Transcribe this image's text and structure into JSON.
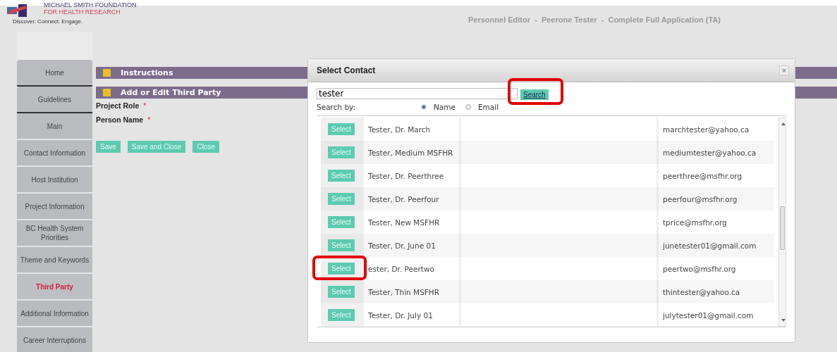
{
  "logo": {
    "line_1": "MICHAEL SMITH FOUNDATION",
    "line_2": "FOR HEALTH RESEARCH",
    "tagline": "Discover. Connect. Engage."
  },
  "page_title": "Personnel Editor  -  Peerone Tester  -  Complete Full Application (TA)",
  "sidebar": {
    "items": [
      {
        "label": "Home",
        "selected": false
      },
      {
        "label": "Guidelines",
        "selected": false
      },
      {
        "label": "Main",
        "selected": false
      },
      {
        "label": "Contact Information",
        "selected": false
      },
      {
        "label": "Host Institution",
        "selected": false
      },
      {
        "label": "Project Information",
        "selected": false
      },
      {
        "label": "BC Health System Priorities",
        "selected": false
      },
      {
        "label": "Theme and Keywords",
        "selected": false
      },
      {
        "label": "Third Party",
        "selected": true
      },
      {
        "label": "Additional Information",
        "selected": false
      },
      {
        "label": "Career Interruptions",
        "selected": false
      }
    ]
  },
  "sections": [
    {
      "title": "Instructions"
    },
    {
      "title": "Add or Edit Third Party"
    }
  ],
  "form_fields": [
    {
      "label": "Project Role",
      "required": "*"
    },
    {
      "label": "Person Name",
      "required": "*"
    }
  ],
  "form_buttons": [
    "Save",
    "Save and Close",
    "Close"
  ],
  "dialog": {
    "title": "Select Contact",
    "close": "×",
    "search": {
      "value": "tester",
      "button": "Search",
      "highlighted": true
    },
    "search_by": {
      "label": "Search by:",
      "options": [
        {
          "label": "Name",
          "selected": true
        },
        {
          "label": "Email",
          "selected": false
        }
      ]
    },
    "rows": [
      {
        "button": "Select",
        "name": "Tester, Dr. March",
        "email": "marchtester@yahoo.ca",
        "highlighted": false
      },
      {
        "button": "Select",
        "name": "Tester, Medium MSFHR",
        "email": "mediumtester@yahoo.ca",
        "highlighted": false
      },
      {
        "button": "Select",
        "name": "Tester, Dr. Peerthree",
        "email": "peerthree@msfhr.org",
        "highlighted": false
      },
      {
        "button": "Select",
        "name": "Tester, Dr. Peerfour",
        "email": "peerfour@msfhr.org",
        "highlighted": false
      },
      {
        "button": "Select",
        "name": "Tester, New MSFHR",
        "email": "tprice@msfhr.org",
        "highlighted": false
      },
      {
        "button": "Select",
        "name": "Tester, Dr. June 01",
        "email": "junetester01@gmail.com",
        "highlighted": false
      },
      {
        "button": "Select",
        "name": "ester, Dr. Peertwo",
        "email": "peertwo@msfhr.org",
        "highlighted": true
      },
      {
        "button": "Select",
        "name": "Tester, Thin MSFHR",
        "email": "thintester@yahoo.ca",
        "highlighted": false
      },
      {
        "button": "Select",
        "name": "Tester, Dr. July 01",
        "email": "julytester01@gmail.com",
        "highlighted": false
      }
    ]
  }
}
